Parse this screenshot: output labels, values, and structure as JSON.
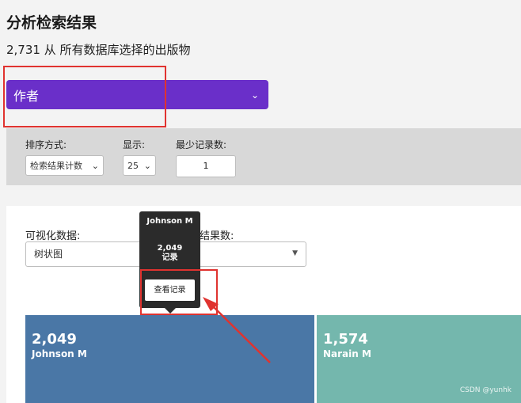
{
  "header": {
    "title": "分析检索结果",
    "subtitle": "2,731 从 所有数据库选择的出版物"
  },
  "field_select": {
    "label": "作者",
    "chevron": "⌄"
  },
  "options": {
    "sort_label": "排序方式:",
    "sort_value": "检索结果计数",
    "show_label": "显示:",
    "show_value": "25",
    "min_label": "最少记录数:",
    "min_value": "1",
    "chevron": "⌄"
  },
  "viz": {
    "viz_label": "可视化数据:",
    "viz_value": "树状图",
    "count_label": "结果数:",
    "caret": "▼"
  },
  "treemap": [
    {
      "count": "2,049",
      "name": "Johnson M",
      "color": "#4a77a6"
    },
    {
      "count": "1,574",
      "name": "Narain M",
      "color": "#74b7ad"
    }
  ],
  "tooltip": {
    "name": "Johnson M",
    "count": "2,049",
    "unit": "记录",
    "button": "查看记录"
  },
  "annotation_color": "#e0332f",
  "accent_color": "#6a2fc9",
  "watermark": "CSDN @yunhk"
}
